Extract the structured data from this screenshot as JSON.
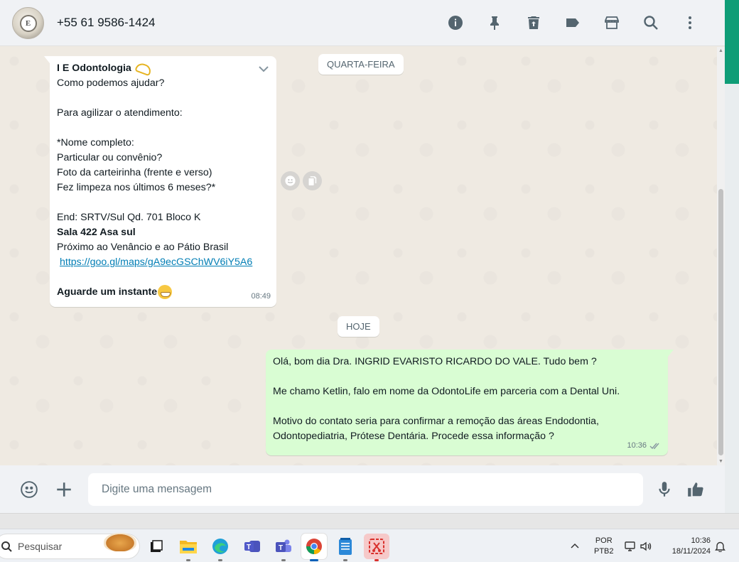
{
  "header": {
    "contact_name": "+55 61 9586-1424",
    "avatar_letter": "E",
    "icons": [
      "info-icon",
      "pin-icon",
      "trash-icon",
      "label-icon",
      "store-icon",
      "search-icon",
      "kebab-menu-icon"
    ]
  },
  "chat": {
    "date_chip_1": "QUARTA-FEIRA",
    "date_chip_2": "HOJE",
    "incoming": {
      "sender": "I E Odontologia",
      "lines": [
        "Como podemos ajudar?",
        "",
        "Para agilizar o atendimento:",
        "",
        "*Nome completo:",
        "Particular ou convênio?",
        "Foto da carteirinha (frente e verso)",
        "Fez limpeza nos últimos 6 meses?*",
        "",
        "End: SRTV/Sul Qd. 701 Bloco K"
      ],
      "bold_line": "Sala 422 Asa sul",
      "line_after_bold": "Próximo ao Venâncio e ao Pátio Brasil",
      "link": "https://goo.gl/maps/gA9ecGSChWV6iY5A6",
      "closing": "Aguarde um instante",
      "time": "08:49"
    },
    "outgoing": {
      "lines": [
        "Olá, bom dia Dra.  INGRID EVARISTO RICARDO DO VALE. Tudo bem ?",
        "",
        "Me chamo Ketlin, falo em nome da OdontoLife em parceria com a Dental Uni.",
        "",
        "Motivo do contato seria para confirmar a remoção das áreas Endodontia,",
        "Odontopediatria, Prótese Dentária. Procede essa informação ?"
      ],
      "time": "10:36"
    }
  },
  "composer": {
    "placeholder": "Digite uma mensagem"
  },
  "taskbar": {
    "search_label": "Pesquisar",
    "lang_1": "POR",
    "lang_2": "PTB2",
    "time": "10:36",
    "date": "18/11/2024"
  },
  "colors": {
    "accent_green": "#0f9d77",
    "outgoing_bubble": "#d9fdd3",
    "chat_background": "#efeae2",
    "link": "#027eb5"
  }
}
